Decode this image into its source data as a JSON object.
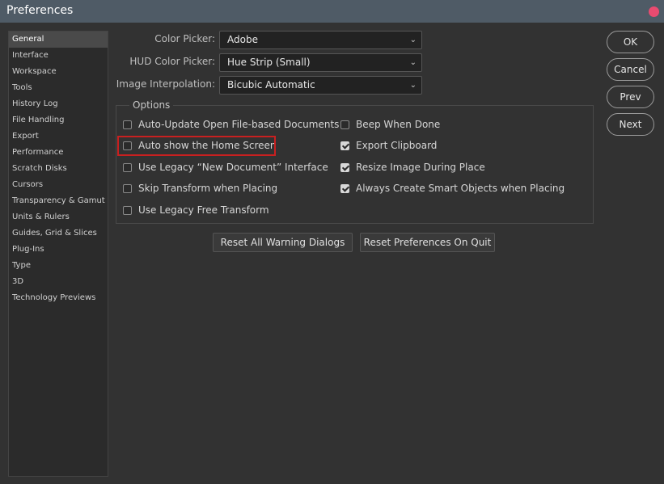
{
  "window": {
    "title": "Preferences"
  },
  "sidebar": {
    "items": [
      {
        "label": "General",
        "selected": true
      },
      {
        "label": "Interface"
      },
      {
        "label": "Workspace"
      },
      {
        "label": "Tools"
      },
      {
        "label": "History Log"
      },
      {
        "label": "File Handling"
      },
      {
        "label": "Export"
      },
      {
        "label": "Performance"
      },
      {
        "label": "Scratch Disks"
      },
      {
        "label": "Cursors"
      },
      {
        "label": "Transparency & Gamut"
      },
      {
        "label": "Units & Rulers"
      },
      {
        "label": "Guides, Grid & Slices"
      },
      {
        "label": "Plug-Ins"
      },
      {
        "label": "Type"
      },
      {
        "label": "3D"
      },
      {
        "label": "Technology Previews"
      }
    ]
  },
  "fields": {
    "color_picker": {
      "label": "Color Picker:",
      "value": "Adobe"
    },
    "hud_color_picker": {
      "label": "HUD Color Picker:",
      "value": "Hue Strip (Small)"
    },
    "image_interpolation": {
      "label": "Image Interpolation:",
      "value": "Bicubic Automatic"
    }
  },
  "options": {
    "legend": "Options",
    "left": [
      {
        "label": "Auto-Update Open File-based Documents",
        "checked": false
      },
      {
        "label": "Auto show the Home Screen",
        "checked": false
      },
      {
        "label": "Use Legacy “New Document” Interface",
        "checked": false
      },
      {
        "label": "Skip Transform when Placing",
        "checked": false
      },
      {
        "label": "Use Legacy Free Transform",
        "checked": false
      }
    ],
    "right": [
      {
        "label": "Beep When Done",
        "checked": false
      },
      {
        "label": "Export Clipboard",
        "checked": true
      },
      {
        "label": "Resize Image During Place",
        "checked": true
      },
      {
        "label": "Always Create Smart Objects when Placing",
        "checked": true
      }
    ]
  },
  "buttons": {
    "reset_warnings": "Reset All Warning Dialogs",
    "reset_prefs": "Reset Preferences On Quit",
    "ok": "OK",
    "cancel": "Cancel",
    "prev": "Prev",
    "next": "Next"
  },
  "colors": {
    "titlebar": "#4f5b66",
    "close_dot": "#e94b70",
    "highlight": "#c82020"
  }
}
